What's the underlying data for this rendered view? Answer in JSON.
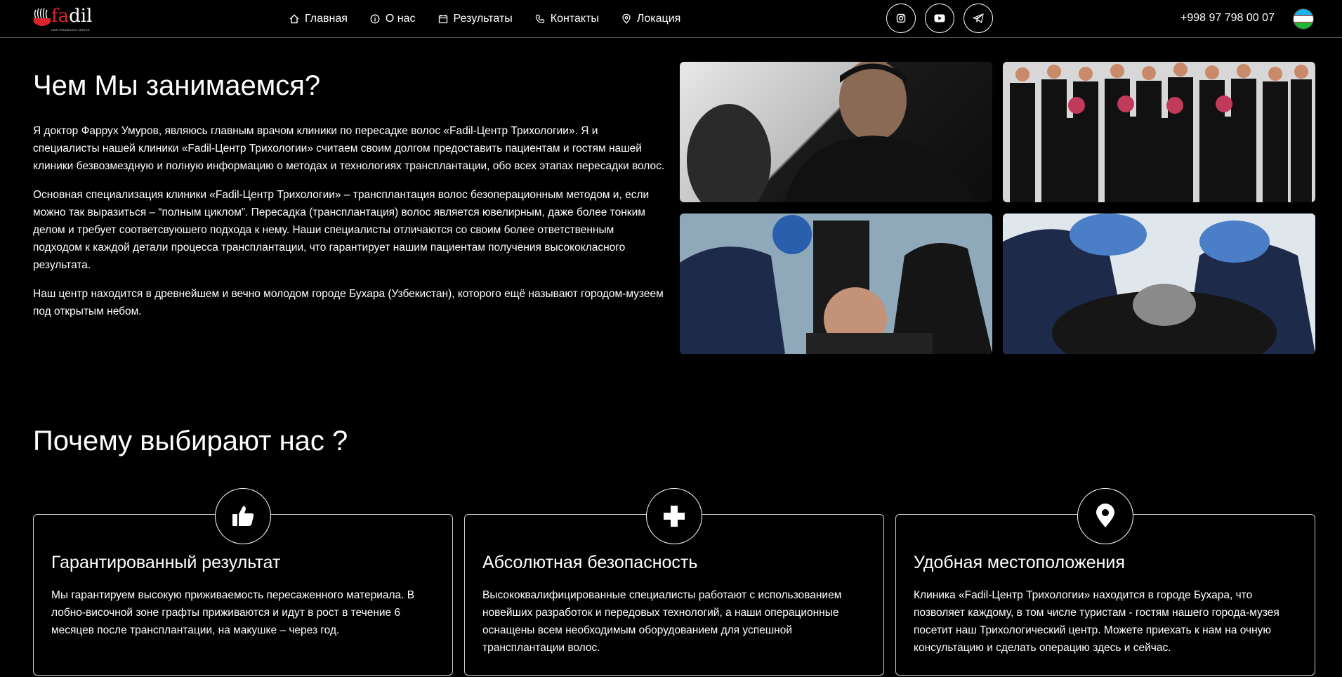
{
  "header": {
    "logo_text": "fadil",
    "logo_subtitle": "HAIR TRANSPLANT CENTER",
    "nav": [
      {
        "label": "Главная",
        "icon": "home-icon"
      },
      {
        "label": "О нас",
        "icon": "info-icon"
      },
      {
        "label": "Результаты",
        "icon": "calendar-icon"
      },
      {
        "label": "Контакты",
        "icon": "phone-icon"
      },
      {
        "label": "Локация",
        "icon": "location-pin-icon"
      }
    ],
    "social": [
      "instagram-icon",
      "youtube-icon",
      "telegram-icon"
    ],
    "phone": "+998 97 798 00 07",
    "language_flag": "uzbekistan-flag"
  },
  "about": {
    "title": "Чем Мы занимаемся?",
    "paragraphs": [
      "Я доктор Фаррух Умуров, являюсь главным врачом клиники по пересадке волос «Fadil-Центр Трихологии». Я и специалисты нашей клиники «Fadil-Центр Трихологии» считаем своим долгом предоставить пациентам и гостям нашей клиники безвозмездную и полную информацию о методах и технологиях трансплантации, обо всех этапах пересадки волос.",
      "Основная специализация клиники «Fadil-Центр Трихологии» – трансплантация волос безоперационным методом и, если можно так выразиться – “полным циклом”. Пересадка (трансплантация) волос является ювелирным, даже более тонким делом и требует соответсвуюшего подхода к нему. Наши специалисты отличаются со своим более ответственным подходом к каждой детали процесса трансплантации, что гарантирует нашим пациентам получения высококласного результата.",
      "Наш центр находится в древнейшем и вечно молодом городе Бухара (Узбекистан), которого ещё называют городом-музеем под открытым небом."
    ]
  },
  "why": {
    "title": "Почему выбирают нас ?",
    "cards": [
      {
        "icon": "thumbs-up-icon",
        "title": "Гарантированный результат",
        "text": "Мы гарантируем высокую приживаемость пересаженного материала. В лобно-височной зоне графты приживаются и идут в рост в течение 6 месяцев после трансплантации, на макушке – через год."
      },
      {
        "icon": "plus-icon",
        "title": "Абсолютная безопасность",
        "text": "Высококвалифицированные специалисты работают с использованием новейших разработок и передовых технологий, а наши операционные оснащены всем необходимым оборудованием для успешной трансплантации волос."
      },
      {
        "icon": "location-pin-icon",
        "title": "Удобная местоположения",
        "text": "Клиника «Fadil-Центр Трихологии» находится в городе Бухара, что позволяет каждому, в том числе туристам - гостям нашего города-музея посетит наш Трихологический центр. Можете приехать к нам на очную консультацию и сделать операцию здесь и сейчас."
      }
    ]
  },
  "colors": {
    "background": "#000000",
    "text": "#ffffff",
    "brand_red": "#d8262b",
    "border": "#cfcfcf"
  }
}
